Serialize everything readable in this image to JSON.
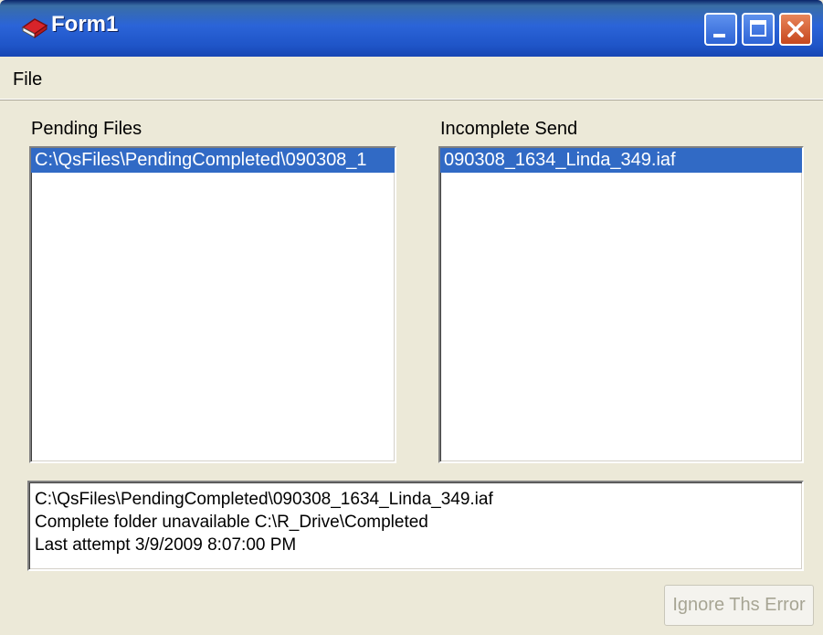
{
  "window": {
    "title": "Form1",
    "icon": "app-book-icon"
  },
  "menu": {
    "file_label": "File"
  },
  "pending": {
    "label": "Pending Files",
    "items": [
      {
        "text": "C:\\QsFiles\\PendingCompleted\\090308_1",
        "selected": true
      }
    ]
  },
  "incomplete": {
    "label": "Incomplete Send",
    "items": [
      {
        "text": "090308_1634_Linda_349.iaf",
        "selected": true
      }
    ]
  },
  "details": {
    "lines": [
      "C:\\QsFiles\\PendingCompleted\\090308_1634_Linda_349.iaf",
      "Complete folder unavailable C:\\R_Drive\\Completed",
      "Last attempt 3/9/2009 8:07:00 PM"
    ]
  },
  "buttons": {
    "ignore_label": "Ignore Ths Error",
    "ignore_enabled": false
  },
  "colors": {
    "titlebar": "#2b64d8",
    "selection": "#316ac5",
    "face": "#ece9d8"
  }
}
